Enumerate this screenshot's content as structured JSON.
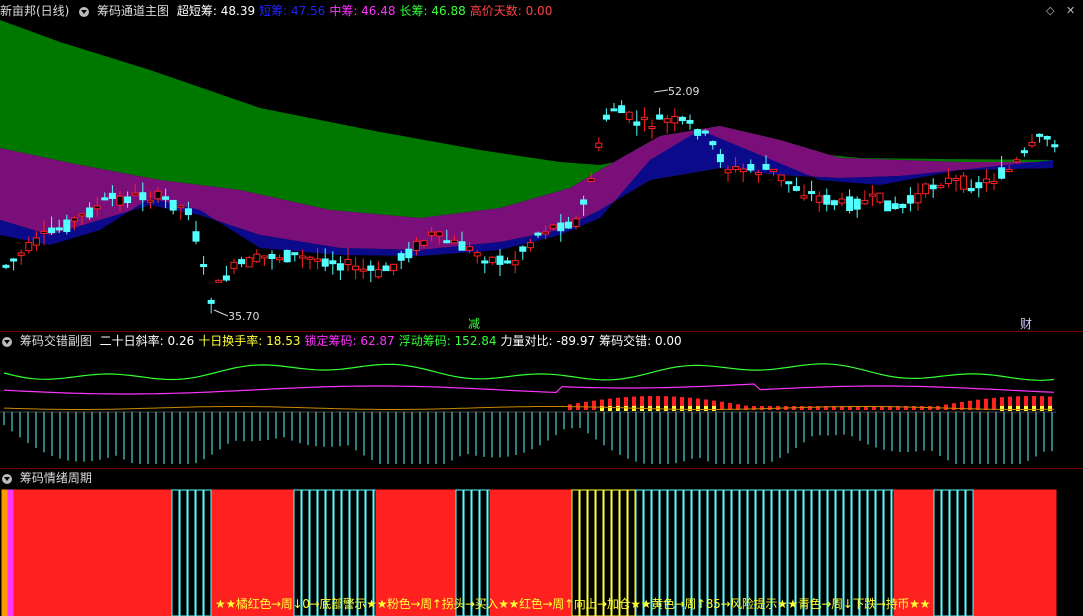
{
  "main": {
    "app_title": "新亩邦(日线)",
    "indicator_name": "筹码通道主图",
    "fields": [
      {
        "label": "超短筹",
        "value": "48.39",
        "color": "#ffffff"
      },
      {
        "label": "短筹",
        "value": "47.56",
        "color": "#2222ff"
      },
      {
        "label": "中筹",
        "value": "46.48",
        "color": "#ff33ff"
      },
      {
        "label": "长筹",
        "value": "46.88",
        "color": "#33ff33"
      },
      {
        "label": "高价天数",
        "value": "0.00",
        "color": "#ff4444"
      }
    ],
    "high_label": "52.09",
    "low_label": "35.70",
    "marker_jian": "减",
    "marker_cai": "财"
  },
  "sub": {
    "indicator_name": "筹码交错副图",
    "fields": [
      {
        "label": "二十日斜率",
        "value": "0.26",
        "color": "#ffffff"
      },
      {
        "label": "十日换手率",
        "value": "18.53",
        "color": "#ffff33"
      },
      {
        "label": "锁定筹码",
        "value": "62.87",
        "color": "#ff33ff"
      },
      {
        "label": "浮动筹码",
        "value": "152.84",
        "color": "#33ff33"
      },
      {
        "label": "力量对比",
        "value": "-89.97",
        "color": "#ffffff"
      },
      {
        "label": "筹码交错",
        "value": "0.00",
        "color": "#ffffff"
      }
    ]
  },
  "cycle": {
    "indicator_name": "筹码情绪周期",
    "legend": "★★橘红色→周↓0→底部警示★★粉色→周↑拐头→买入★★红色→周↑向上→加仓★★黄色→周↑85→风险提示★★青色→周↓下跌→持币★★"
  },
  "colors": {
    "up": "#ff2020",
    "down": "#54ffff",
    "long_band": "#007800",
    "mid_band": "#7a0f7a",
    "short_band": "#0a0a8a"
  },
  "icons": [
    "dropdown-icon",
    "diamond-icon",
    "close-icon"
  ]
}
